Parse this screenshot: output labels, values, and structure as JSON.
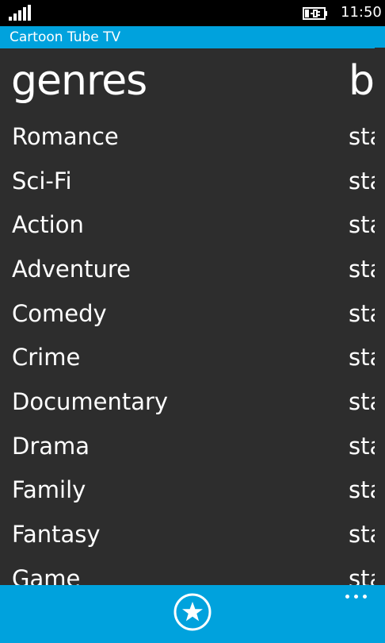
{
  "status_bar": {
    "time": "11:50",
    "signal_icon": "signal-strength-icon",
    "battery_icon": "battery-charging-icon"
  },
  "app": {
    "title": "Cartoon Tube TV"
  },
  "pivot": {
    "current_header": "genres",
    "next_header_partial": "br",
    "genres": [
      "Romance",
      "Sci-Fi",
      "Action",
      "Adventure",
      "Comedy",
      "Crime",
      "Documentary",
      "Drama",
      "Family",
      "Fantasy",
      "Game"
    ],
    "next_items_partial": [
      "sta",
      "sta",
      "sta",
      "sta",
      "sta",
      "sta",
      "sta",
      "sta",
      "sta",
      "sta",
      "sta"
    ]
  },
  "app_bar": {
    "favorite_icon": "star-icon",
    "more_icon": "more-ellipsis-icon"
  },
  "colors": {
    "accent": "#00a2dd",
    "background": "#2d2d2d",
    "status_bar": "#000000",
    "text": "#ffffff"
  }
}
